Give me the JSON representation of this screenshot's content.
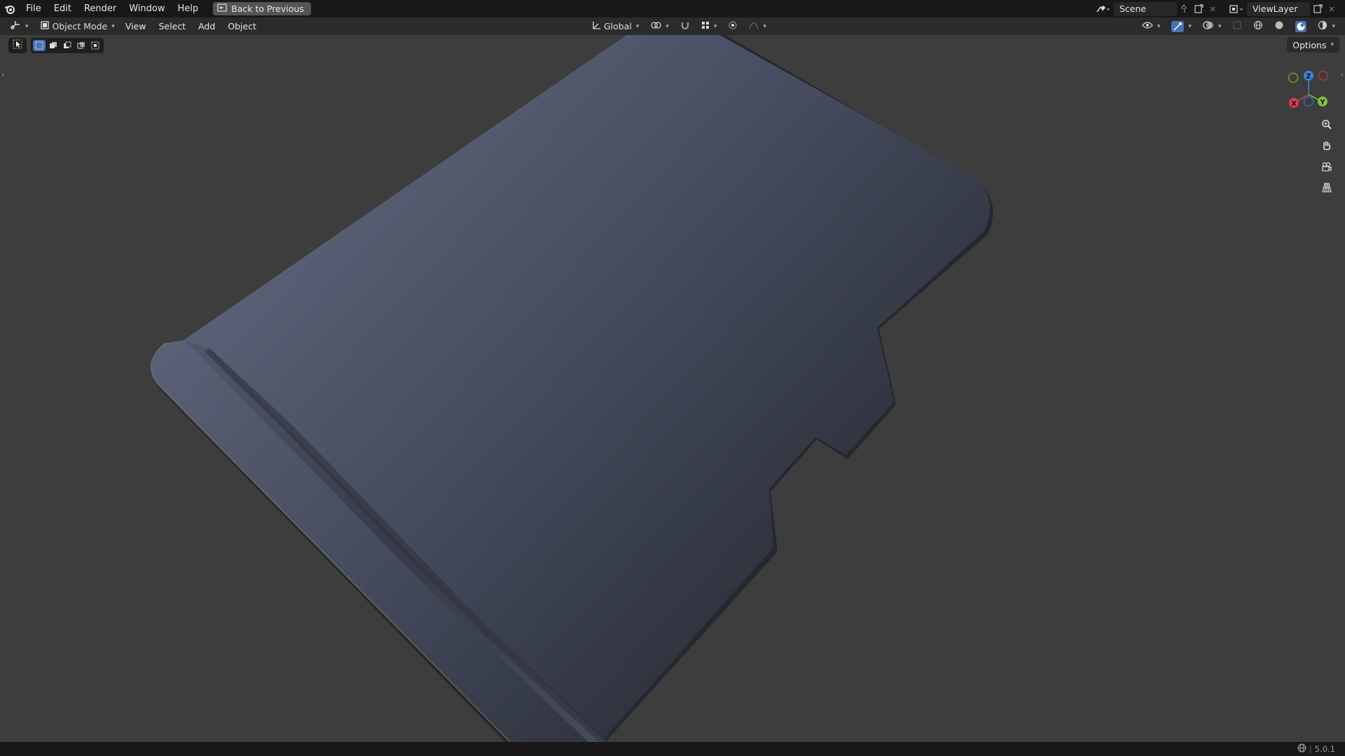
{
  "topbar": {
    "menus": [
      "File",
      "Edit",
      "Render",
      "Window",
      "Help"
    ],
    "back_label": "Back to Previous",
    "scene_label": "Scene",
    "viewlayer_label": "ViewLayer"
  },
  "header": {
    "mode_label": "Object Mode",
    "menus": [
      "View",
      "Select",
      "Add",
      "Object"
    ],
    "orientation_label": "Global"
  },
  "viewport": {
    "options_label": "Options",
    "gizmo_axes": {
      "x": "X",
      "y": "Y",
      "z": "Z"
    }
  },
  "statusbar": {
    "version": "5.0.1"
  },
  "colors": {
    "accent": "#4772b3",
    "axis_x": "#e3394f",
    "axis_y": "#83c03a",
    "axis_z": "#3d85e0",
    "background": "#3d3d3d"
  }
}
